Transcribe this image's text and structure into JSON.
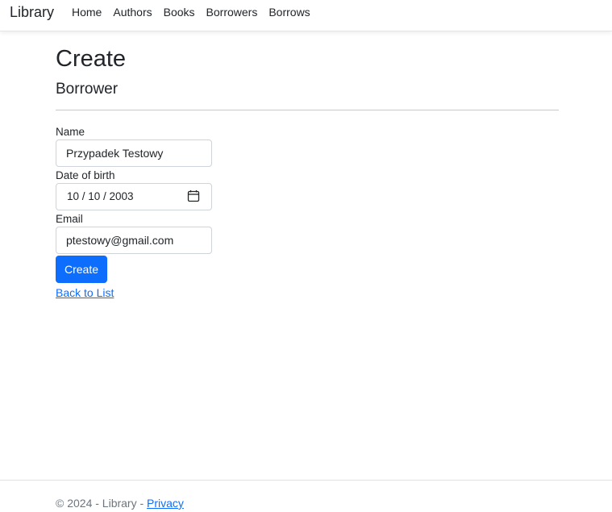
{
  "navbar": {
    "brand": "Library",
    "links": [
      {
        "label": "Home"
      },
      {
        "label": "Authors"
      },
      {
        "label": "Books"
      },
      {
        "label": "Borrowers"
      },
      {
        "label": "Borrows"
      }
    ]
  },
  "page": {
    "title": "Create",
    "subtitle": "Borrower"
  },
  "form": {
    "name": {
      "label": "Name",
      "value": "Przypadek Testowy"
    },
    "dob": {
      "label": "Date of birth",
      "value": "10 / 10 / 2003",
      "icon": "calendar-icon"
    },
    "email": {
      "label": "Email",
      "value": "ptestowy@gmail.com"
    },
    "submit_label": "Create",
    "back_label": "Back to List"
  },
  "footer": {
    "text": "© 2024 - Library - ",
    "privacy_label": "Privacy"
  },
  "colors": {
    "primary": "#0d6efd",
    "text": "#212529",
    "muted": "#6c757d",
    "border": "#ced4da"
  }
}
